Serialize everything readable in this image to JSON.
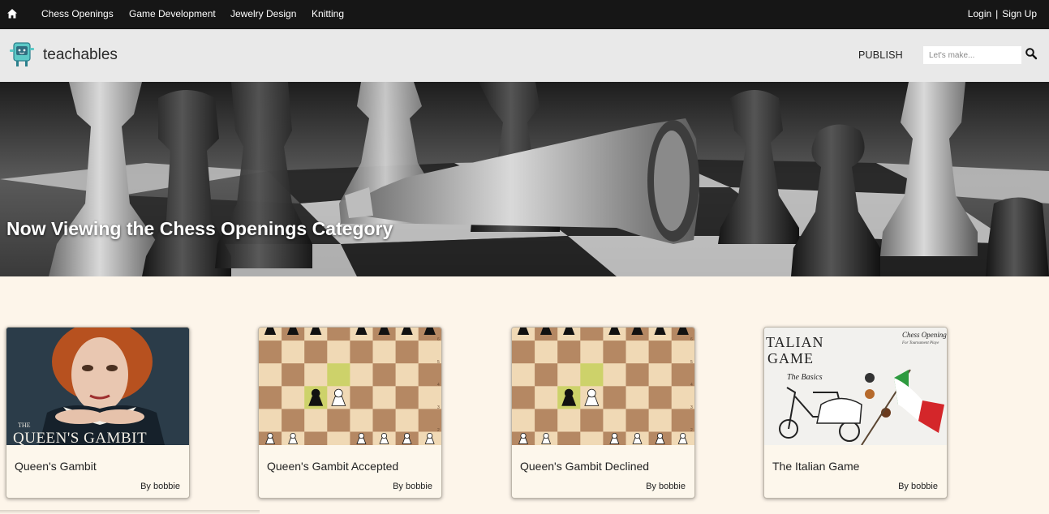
{
  "topnav": {
    "home_icon": "home-icon",
    "categories": [
      "Chess Openings",
      "Game Development",
      "Jewelry Design",
      "Knitting"
    ],
    "login": "Login",
    "separator": "|",
    "signup": "Sign Up"
  },
  "header": {
    "brand": "teachables",
    "logo_icon": "robot-logo-icon",
    "publish": "PUBLISH",
    "search_placeholder": "Let's make...",
    "search_icon": "search-icon"
  },
  "hero": {
    "title": "Now Viewing the Chess Openings Category"
  },
  "cards": [
    {
      "title": "Queen's Gambit",
      "author": "By bobbie",
      "thumb_text": "THE QUEEN'S GAMBIT"
    },
    {
      "title": "Queen's Gambit Accepted",
      "author": "By bobbie"
    },
    {
      "title": "Queen's Gambit Declined",
      "author": "By bobbie"
    },
    {
      "title": "The Italian Game",
      "author": "By bobbie",
      "thumb_text": [
        "TALIAN",
        "GAME",
        "The Basics",
        "Chess Opening",
        "For Tournament Playe"
      ]
    }
  ],
  "colors": {
    "topnav_bg": "#161616",
    "header_bg": "#e9e9e9",
    "page_bg": "#fdf5ea",
    "board_light": "#f0d9b5",
    "board_dark": "#b58863",
    "board_highlight": "#cdd26a"
  }
}
